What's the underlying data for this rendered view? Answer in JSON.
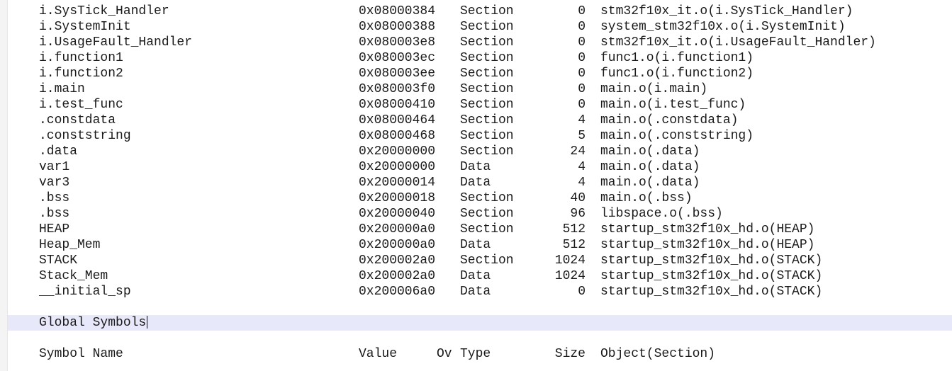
{
  "rows": [
    {
      "symbol": "i.SysTick_Handler",
      "value": "0x08000384",
      "type": "Section",
      "size": "0",
      "object": "stm32f10x_it.o(i.SysTick_Handler)"
    },
    {
      "symbol": "i.SystemInit",
      "value": "0x08000388",
      "type": "Section",
      "size": "0",
      "object": "system_stm32f10x.o(i.SystemInit)"
    },
    {
      "symbol": "i.UsageFault_Handler",
      "value": "0x080003e8",
      "type": "Section",
      "size": "0",
      "object": "stm32f10x_it.o(i.UsageFault_Handler)"
    },
    {
      "symbol": "i.function1",
      "value": "0x080003ec",
      "type": "Section",
      "size": "0",
      "object": "func1.o(i.function1)"
    },
    {
      "symbol": "i.function2",
      "value": "0x080003ee",
      "type": "Section",
      "size": "0",
      "object": "func1.o(i.function2)"
    },
    {
      "symbol": "i.main",
      "value": "0x080003f0",
      "type": "Section",
      "size": "0",
      "object": "main.o(i.main)"
    },
    {
      "symbol": "i.test_func",
      "value": "0x08000410",
      "type": "Section",
      "size": "0",
      "object": "main.o(i.test_func)"
    },
    {
      "symbol": ".constdata",
      "value": "0x08000464",
      "type": "Section",
      "size": "4",
      "object": "main.o(.constdata)"
    },
    {
      "symbol": ".conststring",
      "value": "0x08000468",
      "type": "Section",
      "size": "5",
      "object": "main.o(.conststring)"
    },
    {
      "symbol": ".data",
      "value": "0x20000000",
      "type": "Section",
      "size": "24",
      "object": "main.o(.data)"
    },
    {
      "symbol": "var1",
      "value": "0x20000000",
      "type": "Data",
      "size": "4",
      "object": "main.o(.data)"
    },
    {
      "symbol": "var3",
      "value": "0x20000014",
      "type": "Data",
      "size": "4",
      "object": "main.o(.data)"
    },
    {
      "symbol": ".bss",
      "value": "0x20000018",
      "type": "Section",
      "size": "40",
      "object": "main.o(.bss)"
    },
    {
      "symbol": ".bss",
      "value": "0x20000040",
      "type": "Section",
      "size": "96",
      "object": "libspace.o(.bss)"
    },
    {
      "symbol": "HEAP",
      "value": "0x200000a0",
      "type": "Section",
      "size": "512",
      "object": "startup_stm32f10x_hd.o(HEAP)"
    },
    {
      "symbol": "Heap_Mem",
      "value": "0x200000a0",
      "type": "Data",
      "size": "512",
      "object": "startup_stm32f10x_hd.o(HEAP)"
    },
    {
      "symbol": "STACK",
      "value": "0x200002a0",
      "type": "Section",
      "size": "1024",
      "object": "startup_stm32f10x_hd.o(STACK)"
    },
    {
      "symbol": "Stack_Mem",
      "value": "0x200002a0",
      "type": "Data",
      "size": "1024",
      "object": "startup_stm32f10x_hd.o(STACK)"
    },
    {
      "symbol": "__initial_sp",
      "value": "0x200006a0",
      "type": "Data",
      "size": "0",
      "object": "startup_stm32f10x_hd.o(STACK)"
    }
  ],
  "global_symbols": {
    "heading": "Global Symbols"
  },
  "header": {
    "symbol_name": "Symbol Name",
    "value": "Value",
    "ov": "Ov",
    "type": "Type",
    "size": "Size",
    "object": "Object(Section)"
  },
  "colors": {
    "current_line": "#e8e8fb",
    "text": "#1a1a1a"
  }
}
